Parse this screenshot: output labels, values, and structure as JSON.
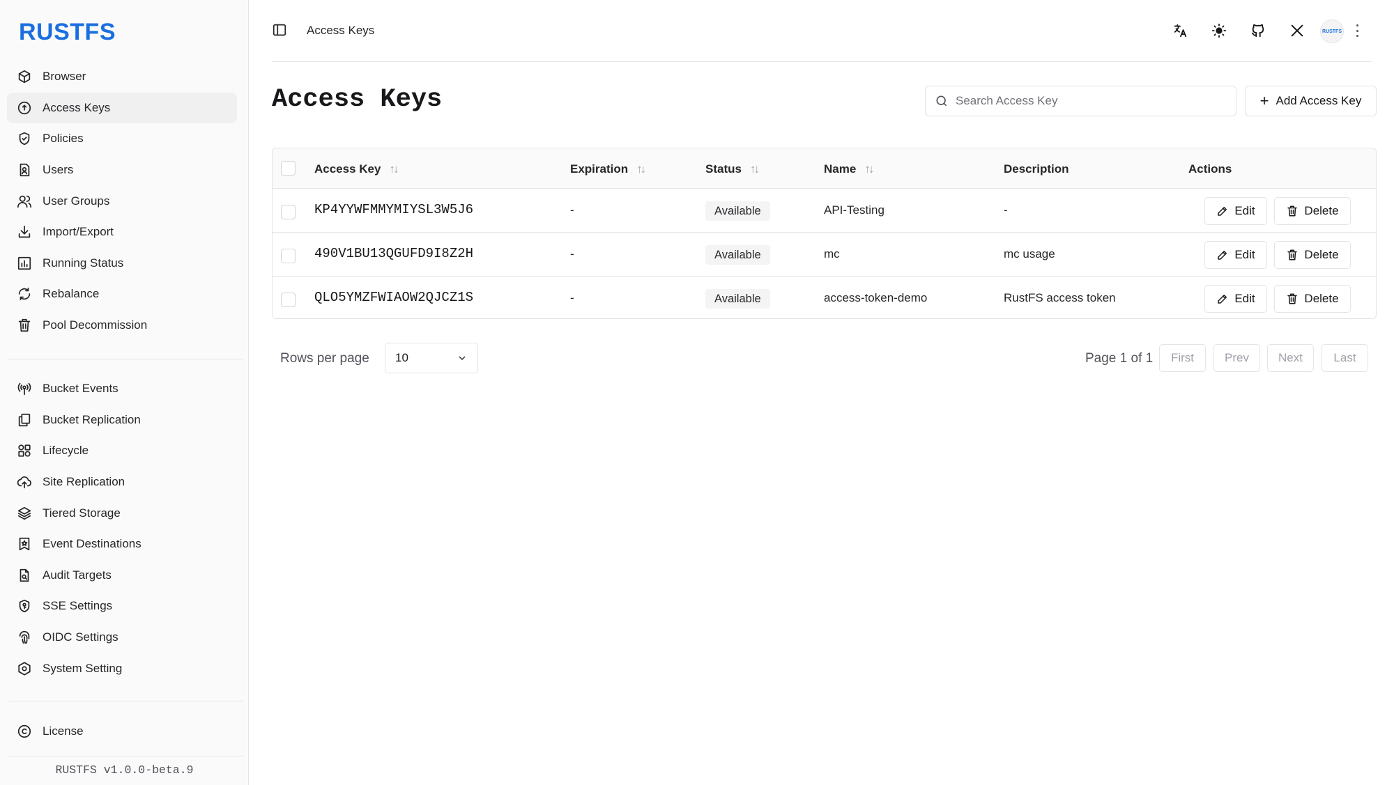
{
  "app": {
    "logo": "RUSTFS",
    "version": "RUSTFS v1.0.0-beta.9"
  },
  "sidebar": {
    "primary": [
      {
        "label": "Browser",
        "icon": "box-icon"
      },
      {
        "label": "Access Keys",
        "icon": "key-icon",
        "active": true
      },
      {
        "label": "Policies",
        "icon": "shield-check-icon"
      },
      {
        "label": "Users",
        "icon": "user-file-icon"
      },
      {
        "label": "User Groups",
        "icon": "users-icon"
      },
      {
        "label": "Import/Export",
        "icon": "download-icon"
      },
      {
        "label": "Running Status",
        "icon": "bar-chart-icon"
      },
      {
        "label": "Rebalance",
        "icon": "refresh-icon"
      },
      {
        "label": "Pool Decommission",
        "icon": "trash-icon"
      }
    ],
    "secondary": [
      {
        "label": "Bucket Events",
        "icon": "broadcast-icon"
      },
      {
        "label": "Bucket Replication",
        "icon": "copy-icon"
      },
      {
        "label": "Lifecycle",
        "icon": "lifecycle-icon"
      },
      {
        "label": "Site Replication",
        "icon": "cloud-upload-icon"
      },
      {
        "label": "Tiered Storage",
        "icon": "layers-icon"
      },
      {
        "label": "Event Destinations",
        "icon": "bookmark-star-icon"
      },
      {
        "label": "Audit Targets",
        "icon": "file-search-icon"
      },
      {
        "label": "SSE Settings",
        "icon": "shield-key-icon"
      },
      {
        "label": "OIDC Settings",
        "icon": "fingerprint-icon"
      },
      {
        "label": "System Setting",
        "icon": "hexagon-gear-icon"
      }
    ],
    "footer": [
      {
        "label": "License",
        "icon": "copyright-icon"
      }
    ]
  },
  "header": {
    "breadcrumb": "Access Keys",
    "avatar_text": "RUSTFS",
    "icons": [
      "translate-icon",
      "sun-icon",
      "github-icon",
      "x-logo-icon"
    ]
  },
  "main": {
    "title": "Access Keys",
    "search_placeholder": "Search Access Key",
    "add_label": "Add Access Key",
    "table": {
      "columns": [
        {
          "label": "Access Key",
          "sortable": true
        },
        {
          "label": "Expiration",
          "sortable": true
        },
        {
          "label": "Status",
          "sortable": true
        },
        {
          "label": "Name",
          "sortable": true
        },
        {
          "label": "Description",
          "sortable": false
        },
        {
          "label": "Actions",
          "sortable": false
        }
      ],
      "sort_glyph": "↑↓",
      "rows": [
        {
          "access_key": "KP4YYWFMMYMIYSL3W5J6",
          "expiration": "-",
          "status": "Available",
          "name": "API-Testing",
          "description": "-"
        },
        {
          "access_key": "490V1BU13QGUFD9I8Z2H",
          "expiration": "-",
          "status": "Available",
          "name": "mc",
          "description": "mc usage"
        },
        {
          "access_key": "QLO5YMZFWIAOW2QJCZ1S",
          "expiration": "-",
          "status": "Available",
          "name": "access-token-demo",
          "description": "RustFS access token"
        }
      ],
      "edit_label": "Edit",
      "delete_label": "Delete"
    },
    "pagination": {
      "rows_per_page_label": "Rows per page",
      "rows_per_page_value": "10",
      "page_info": "Page 1 of 1",
      "first": "First",
      "prev": "Prev",
      "next": "Next",
      "last": "Last"
    }
  },
  "colors": {
    "brand": "#1a6fe0",
    "border": "#e4e4e7",
    "sidebar_bg": "#fafafa",
    "active_bg": "#f0f0f1",
    "disabled_text": "#a1a1aa"
  }
}
